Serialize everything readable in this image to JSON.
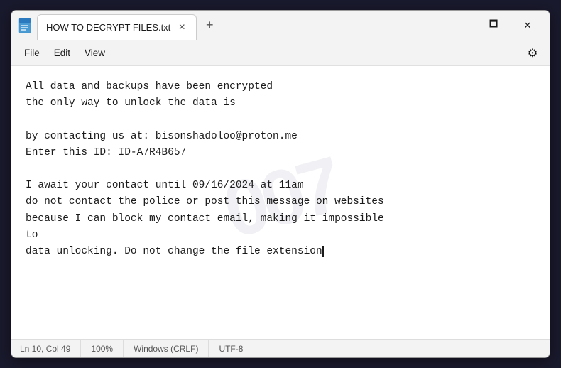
{
  "window": {
    "title": "HOW TO DECRYPT FILES.txt",
    "icon": "📄"
  },
  "titlebar": {
    "minimize_label": "—",
    "maximize_label": "🗖",
    "close_label": "✕",
    "new_tab_label": "+",
    "close_tab_label": "✕"
  },
  "menu": {
    "items": [
      "File",
      "Edit",
      "View"
    ],
    "gear_icon": "⚙"
  },
  "watermark": {
    "text": "007"
  },
  "editor": {
    "content_lines": [
      "All data and backups have been encrypted",
      "the only way to unlock the data is",
      "",
      "by contacting us at: bisonshadoloo@proton.me",
      "Enter this ID: ID-A7R4B657",
      "",
      "I await your contact until 09/16/2024 at 11am",
      "do not contact the police or post this message on websites",
      "because I can block my contact email, making it impossible",
      "to",
      "data unlocking. Do not change the file extension"
    ]
  },
  "statusbar": {
    "position": "Ln 10, Col 49",
    "zoom": "100%",
    "line_ending": "Windows (CRLF)",
    "encoding": "UTF-8"
  }
}
